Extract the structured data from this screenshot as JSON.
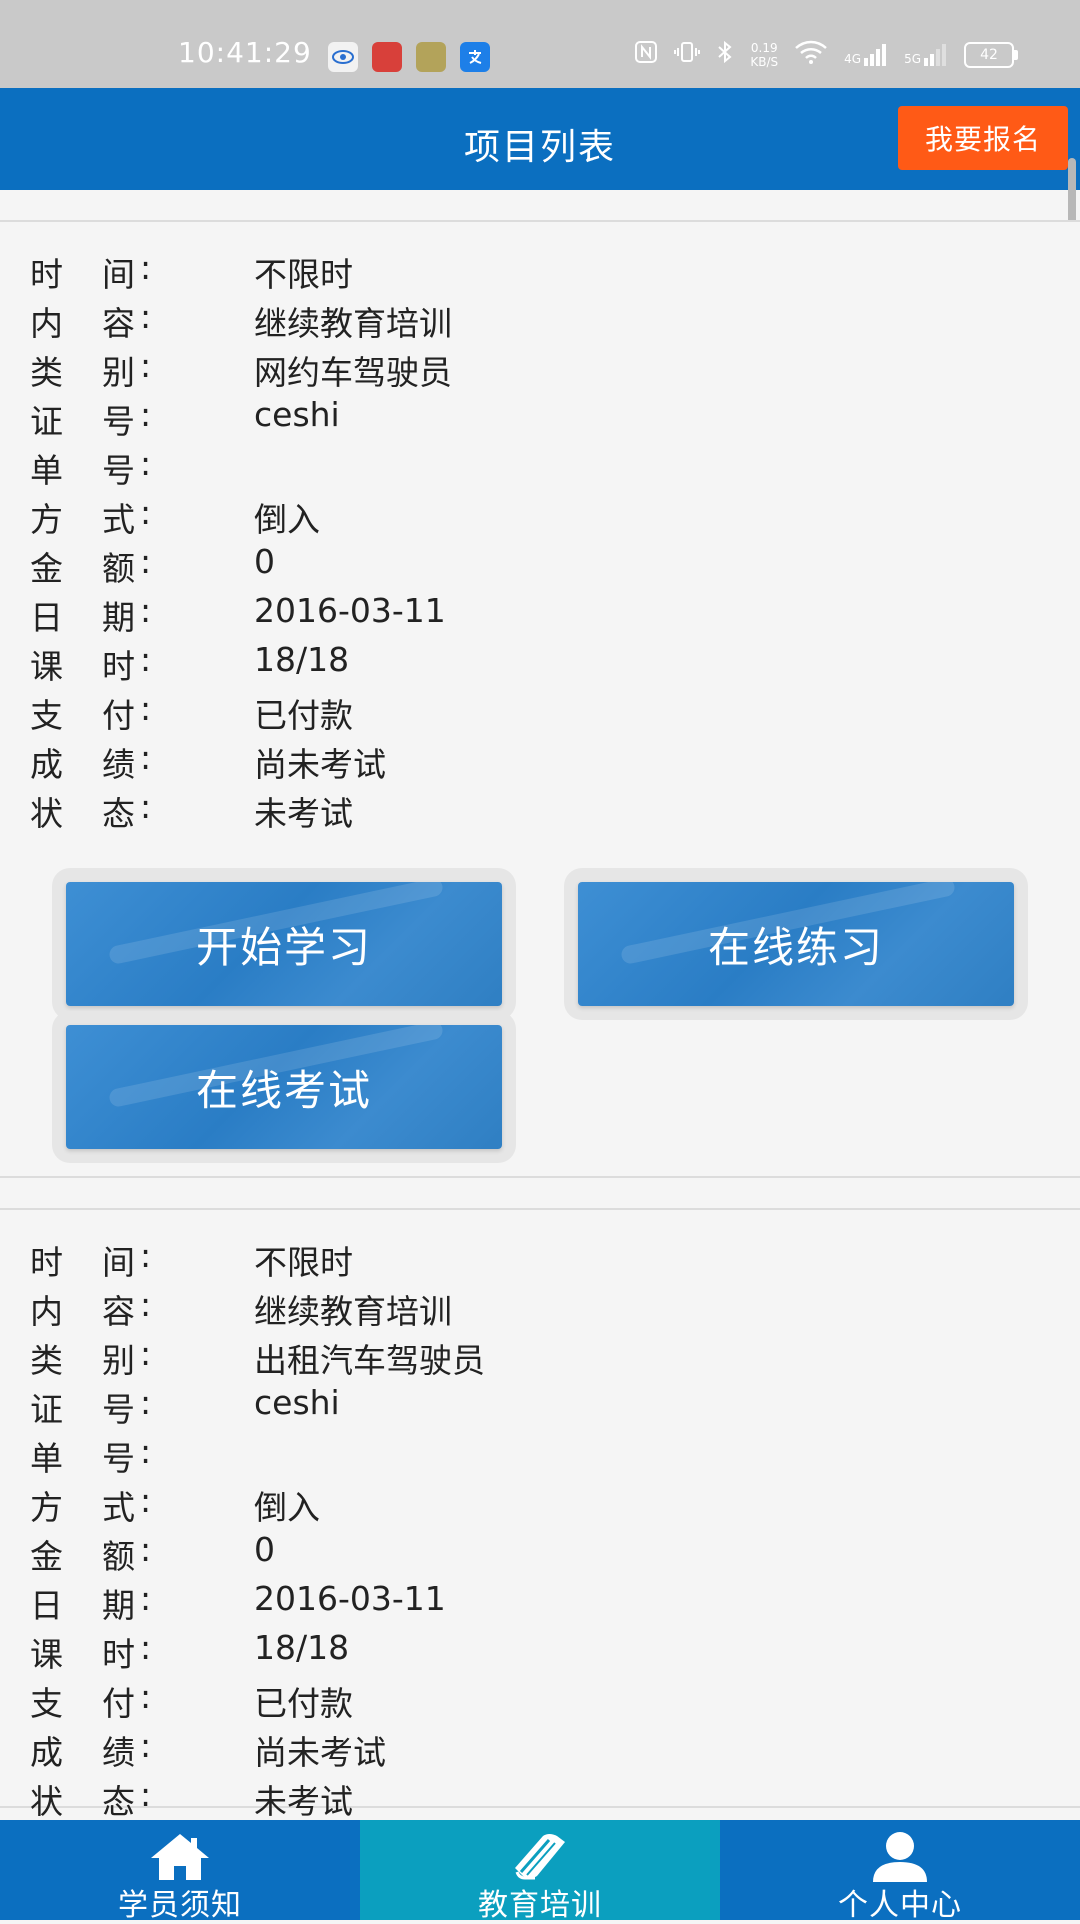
{
  "status_bar": {
    "time": "10:41:29",
    "net_speed": "0.19",
    "net_unit": "KB/S",
    "signal_4g": "4G",
    "signal_5g": "5G",
    "battery": "42"
  },
  "header": {
    "title": "项目列表",
    "register_label": "我要报名"
  },
  "labels": {
    "time": [
      "时",
      "间"
    ],
    "content": [
      "内",
      "容"
    ],
    "category": [
      "类",
      "别"
    ],
    "cert_no": [
      "证",
      "号"
    ],
    "order_no": [
      "单",
      "号"
    ],
    "method": [
      "方",
      "式"
    ],
    "amount": [
      "金",
      "额"
    ],
    "date": [
      "日",
      "期"
    ],
    "hours": [
      "课",
      "时"
    ],
    "payment": [
      "支",
      "付"
    ],
    "score": [
      "成",
      "绩"
    ],
    "status": [
      "状",
      "态"
    ],
    "colon": ":"
  },
  "projects": [
    {
      "time": "不限时",
      "content": "继续教育培训",
      "category": "网约车驾驶员",
      "cert_no": "ceshi",
      "order_no": "",
      "method": "倒入",
      "amount": "0",
      "date": "2016-03-11",
      "hours": "18/18",
      "payment": "已付款",
      "score": "尚未考试",
      "status": "未考试",
      "actions": {
        "start_study": "开始学习",
        "online_practice": "在线练习",
        "online_exam": "在线考试"
      }
    },
    {
      "time": "不限时",
      "content": "继续教育培训",
      "category": "出租汽车驾驶员",
      "cert_no": "ceshi",
      "order_no": "",
      "method": "倒入",
      "amount": "0",
      "date": "2016-03-11",
      "hours": "18/18",
      "payment": "已付款",
      "score": "尚未考试",
      "status": "未考试"
    }
  ],
  "bottom_nav": [
    {
      "label": "学员须知",
      "icon": "home-icon",
      "active": false
    },
    {
      "label": "教育培训",
      "icon": "book-icon",
      "active": true
    },
    {
      "label": "个人中心",
      "icon": "user-icon",
      "active": false
    }
  ],
  "colors": {
    "primary": "#0b6fc0",
    "active_tab": "#0b9fbf",
    "register": "#ff5a16"
  }
}
